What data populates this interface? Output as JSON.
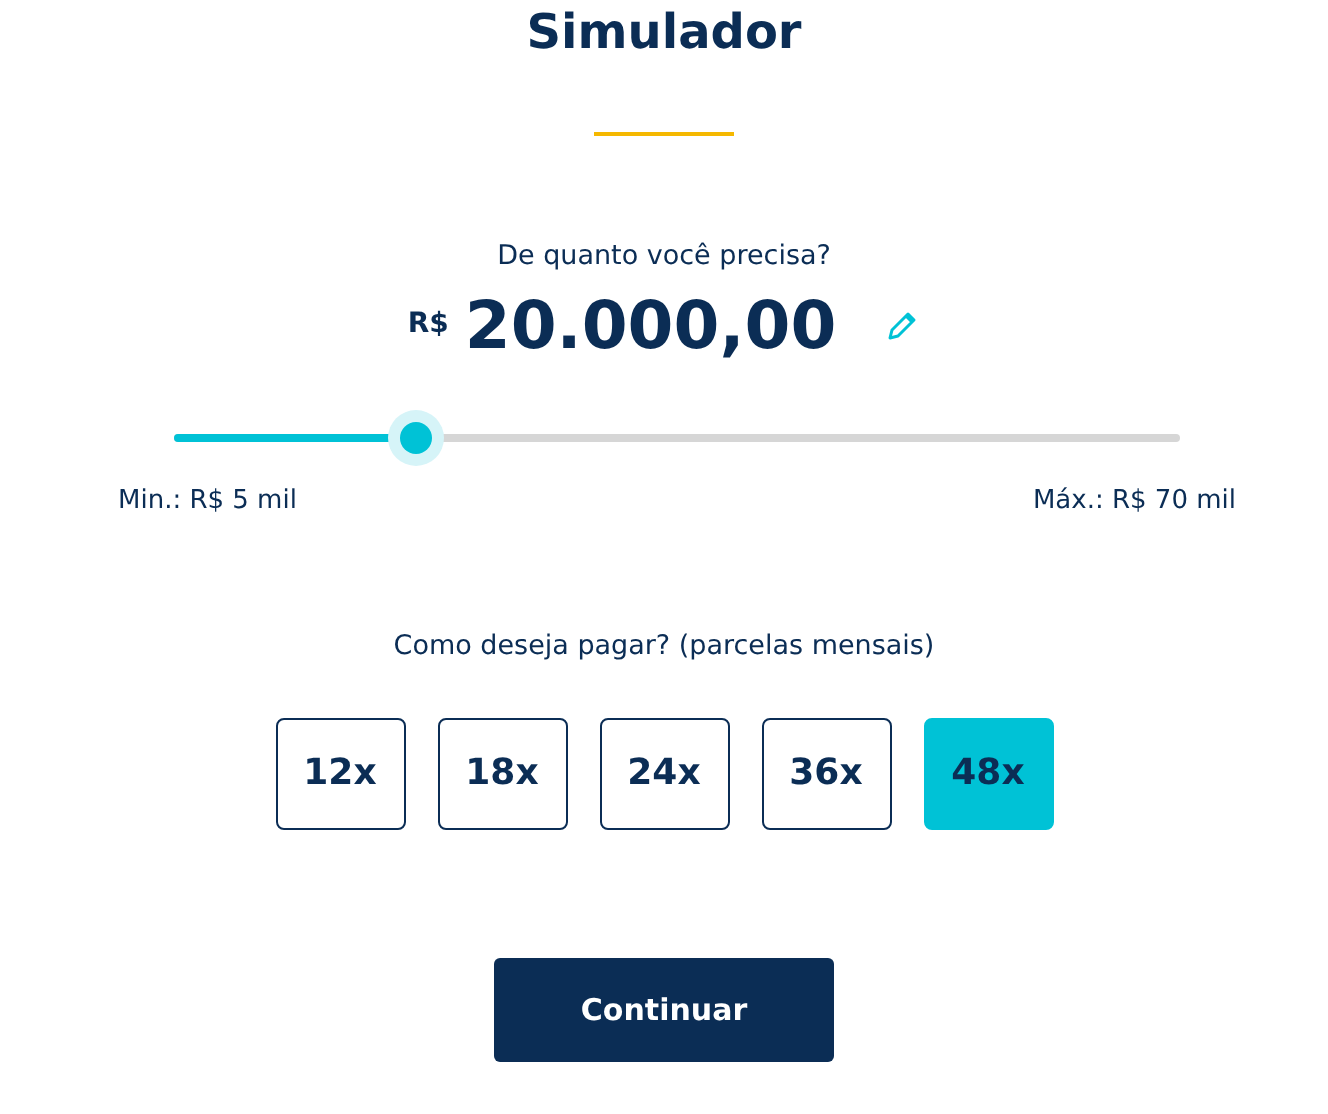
{
  "title": "Simulador",
  "amount": {
    "question": "De quanto você precisa?",
    "currency": "R$",
    "value": "20.000,00"
  },
  "slider": {
    "level": 0.24,
    "min_label": "Min.: R$ 5 mil",
    "max_label": "Máx.: R$ 70 mil"
  },
  "installments": {
    "question": "Como deseja pagar? (parcelas mensais)",
    "options": [
      {
        "label": "12x",
        "selected": false
      },
      {
        "label": "18x",
        "selected": false
      },
      {
        "label": "24x",
        "selected": false
      },
      {
        "label": "36x",
        "selected": false
      },
      {
        "label": "48x",
        "selected": true
      }
    ]
  },
  "button": "Continuar"
}
